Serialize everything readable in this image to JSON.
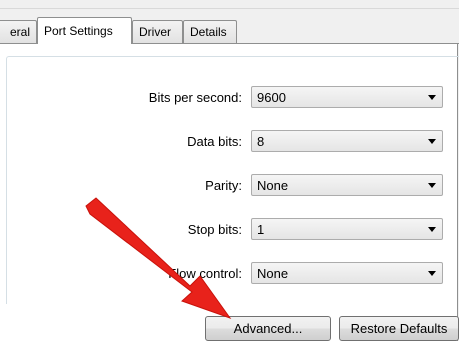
{
  "tabs": [
    {
      "label": "eral"
    },
    {
      "label": "Port Settings"
    },
    {
      "label": "Driver"
    },
    {
      "label": "Details"
    }
  ],
  "settings": {
    "bits_per_second": {
      "label": "Bits per second:",
      "value": "9600"
    },
    "data_bits": {
      "label": "Data bits:",
      "value": "8"
    },
    "parity": {
      "label": "Parity:",
      "value": "None"
    },
    "stop_bits": {
      "label": "Stop bits:",
      "value": "1"
    },
    "flow_control": {
      "label": "Flow control:",
      "value": "None"
    }
  },
  "buttons": {
    "advanced": "Advanced...",
    "restore_defaults": "Restore Defaults"
  },
  "colors": {
    "annotation_arrow": "#e8221b"
  }
}
